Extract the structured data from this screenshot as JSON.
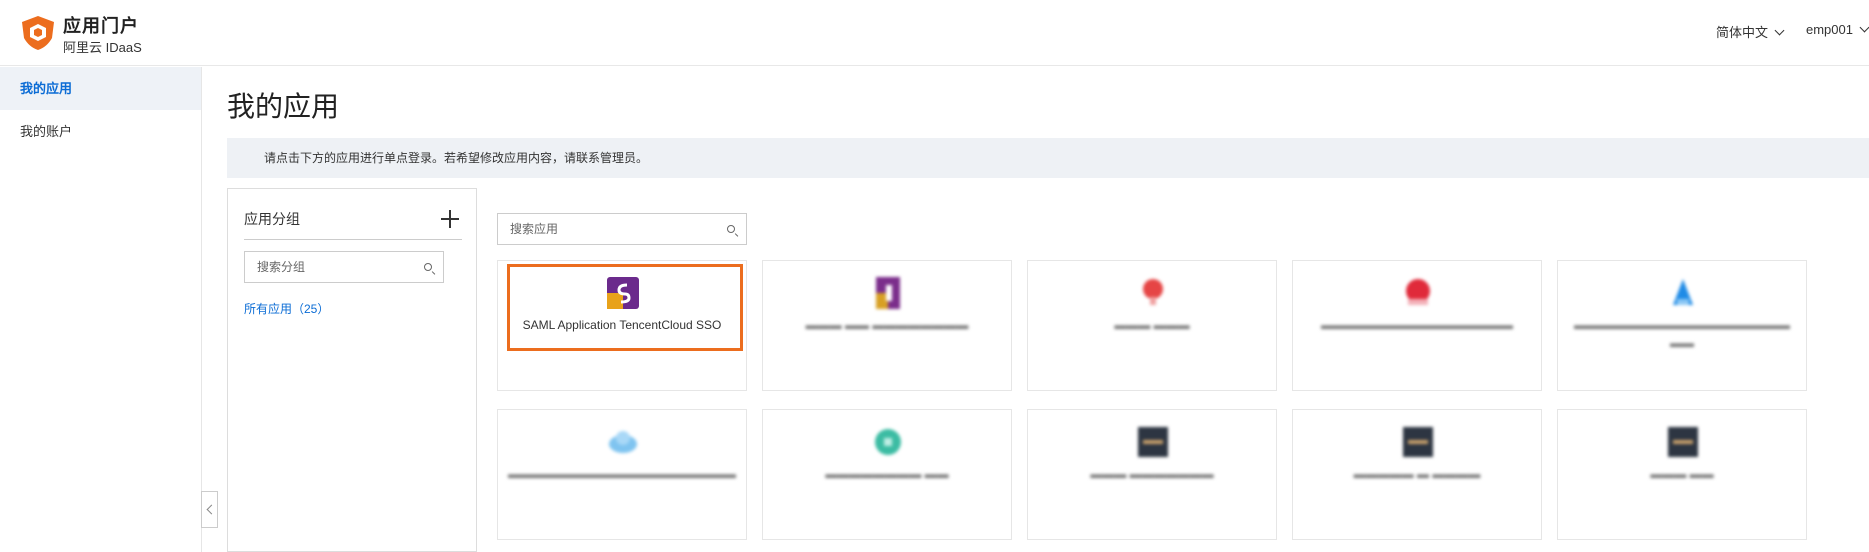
{
  "header": {
    "title": "应用门户",
    "subtitle": "阿里云 IDaaS",
    "language": "简体中文",
    "user": "emp001"
  },
  "sidebar": {
    "items": [
      {
        "label": "我的应用",
        "active": true
      },
      {
        "label": "我的账户",
        "active": false
      }
    ]
  },
  "main": {
    "title": "我的应用",
    "notice": "请点击下方的应用进行单点登录。若希望修改应用内容，请联系管理员。",
    "group_panel": {
      "title": "应用分组",
      "search_placeholder": "搜索分组",
      "all_apps_label": "所有应用（25）"
    },
    "app_search_placeholder": "搜索应用",
    "apps": [
      {
        "name": "SAML Application TencentCloud SSO",
        "icon": "saml-app-icon",
        "selected": true
      },
      {
        "name": "",
        "icon": "purple-app-icon"
      },
      {
        "name": "",
        "icon": "red-pin-icon"
      },
      {
        "name": "",
        "icon": "huawei-icon"
      },
      {
        "name": "",
        "icon": "blue-flame-icon"
      },
      {
        "name": "",
        "icon": "cloud-icon"
      },
      {
        "name": "",
        "icon": "teal-app-icon"
      },
      {
        "name": "",
        "icon": "dark-app-icon"
      },
      {
        "name": "",
        "icon": "dark-app-icon"
      },
      {
        "name": "",
        "icon": "dark-app-icon"
      }
    ]
  },
  "colors": {
    "accent": "#0b6cd5",
    "highlight": "#ec6d1e",
    "logo": "#ec6d1e"
  }
}
